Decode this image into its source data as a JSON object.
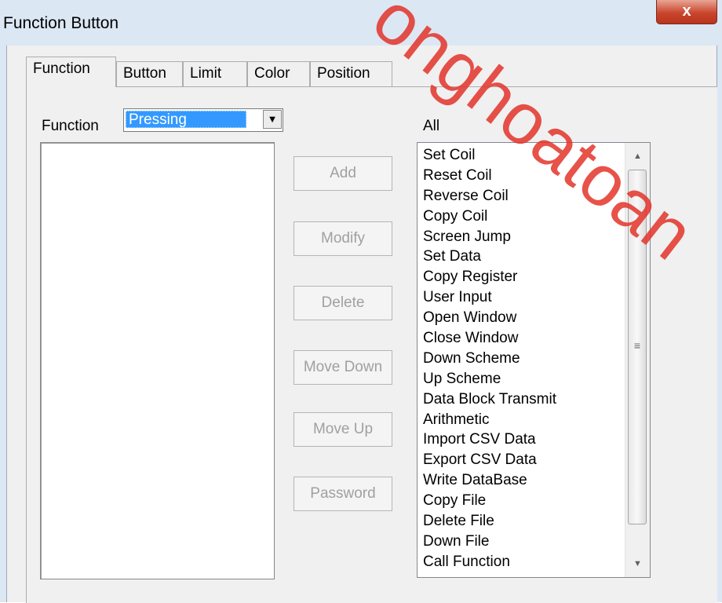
{
  "window": {
    "title": "Function Button",
    "close_glyph": "x"
  },
  "tabs": [
    {
      "label": "Function",
      "active": true
    },
    {
      "label": "Button",
      "active": false
    },
    {
      "label": "Limit",
      "active": false
    },
    {
      "label": "Color",
      "active": false
    },
    {
      "label": "Position",
      "active": false
    }
  ],
  "function_panel": {
    "function_label": "Function",
    "function_select_value": "Pressing",
    "all_label": "All"
  },
  "buttons": {
    "add": "Add",
    "modify": "Modify",
    "delete": "Delete",
    "move_down": "Move Down",
    "move_up": "Move Up",
    "password": "Password"
  },
  "all_functions": [
    "Set Coil",
    "Reset Coil",
    "Reverse Coil",
    "Copy Coil",
    "Screen Jump",
    "Set Data",
    "Copy Register",
    "User Input",
    "Open Window",
    "Close Window",
    "Down Scheme",
    "Up Scheme",
    "Data Block Transmit",
    "Arithmetic",
    "Import CSV Data",
    "Export CSV Data",
    "Write DataBase",
    "Copy File",
    "Delete File",
    "Down File",
    "Call Function"
  ],
  "watermark": {
    "text": "onghoatoan"
  },
  "colors": {
    "selection": "#3399ff",
    "close_button": "#c9462d",
    "watermark": "#e3342a"
  }
}
